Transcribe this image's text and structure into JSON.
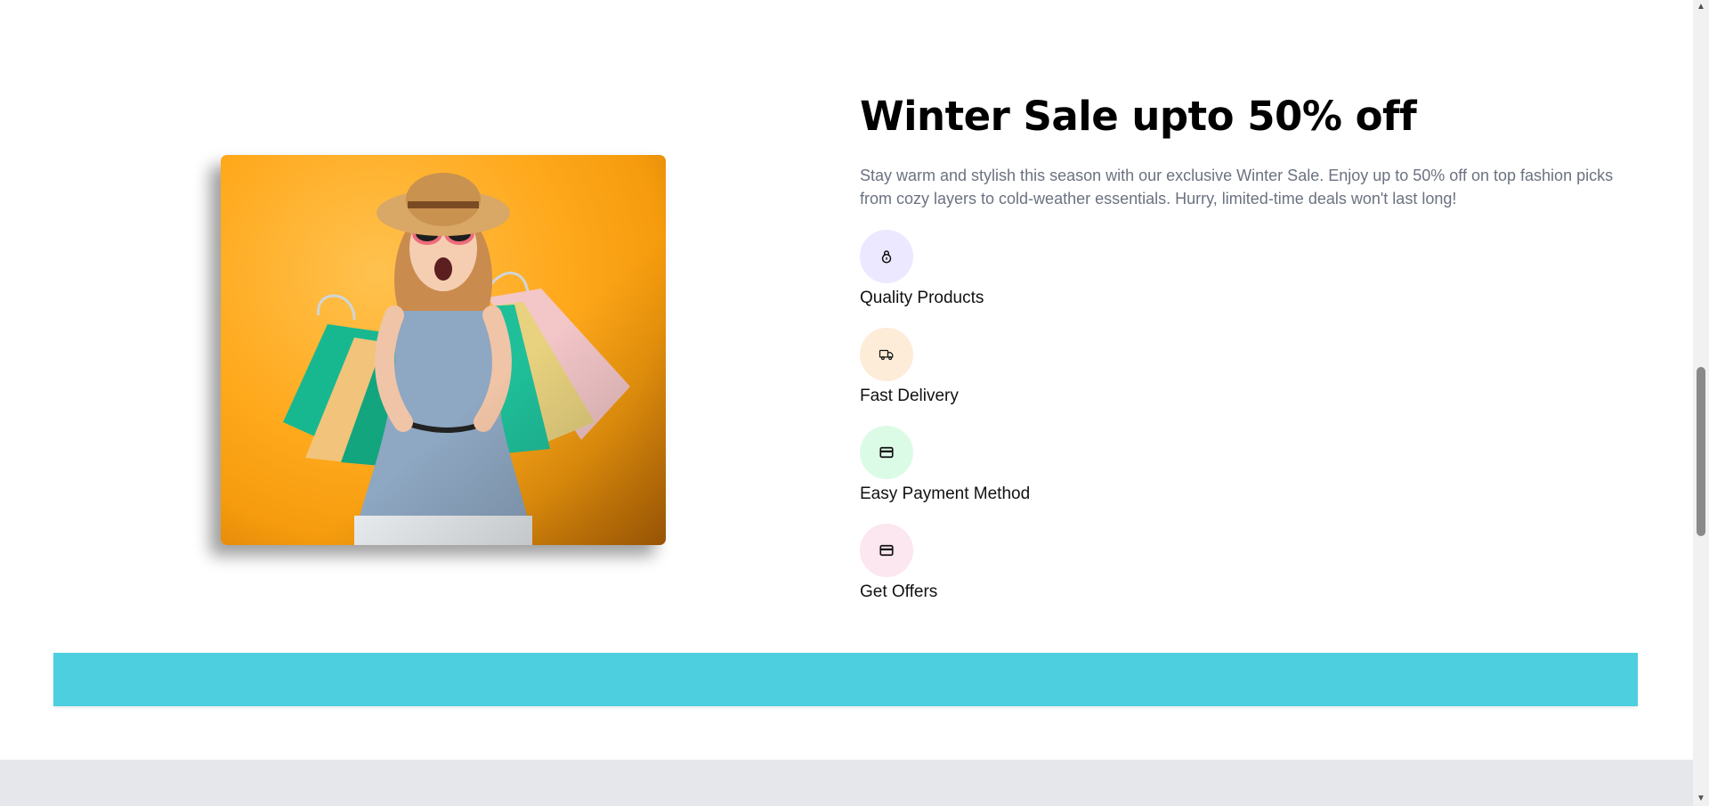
{
  "promo": {
    "title": "Winter Sale upto 50% off",
    "description": "Stay warm and stylish this season with our exclusive Winter Sale. Enjoy up to 50% off on top fashion picks from cozy layers to cold-weather essentials. Hurry, limited-time deals won't last long!",
    "image": "woman-with-shopping-bags"
  },
  "features": [
    {
      "label": "Quality Products",
      "icon": "lock-icon",
      "bg": "#ebe8ff"
    },
    {
      "label": "Fast Delivery",
      "icon": "truck-icon",
      "bg": "#fdecd8"
    },
    {
      "label": "Easy Payment Method",
      "icon": "credit-card-icon",
      "bg": "#dcfbe7"
    },
    {
      "label": "Get Offers",
      "icon": "credit-card-icon",
      "bg": "#fce6ef"
    }
  ],
  "colors": {
    "banner": "#4ecfe0",
    "footer": "#e6e7eb",
    "image_bg": "#ffa91d"
  }
}
